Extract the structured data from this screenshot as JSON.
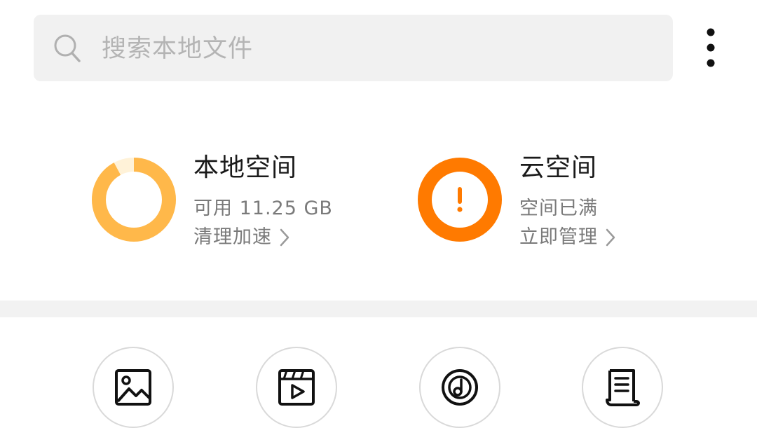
{
  "search": {
    "placeholder": "搜索本地文件",
    "icon": "search-icon"
  },
  "menu": {
    "icon": "more-vertical-icon"
  },
  "local_storage": {
    "title": "本地空间",
    "available": "可用 11.25 GB",
    "action": "清理加速",
    "used_fraction": 0.92,
    "color": "#ffb84a",
    "track_color": "#fff2d8"
  },
  "cloud_storage": {
    "title": "云空间",
    "status": "空间已满",
    "action": "立即管理",
    "color": "#ff7a00",
    "icon": "warning-icon"
  },
  "categories": [
    {
      "icon": "image-icon"
    },
    {
      "icon": "video-icon"
    },
    {
      "icon": "music-icon"
    },
    {
      "icon": "document-icon"
    }
  ]
}
